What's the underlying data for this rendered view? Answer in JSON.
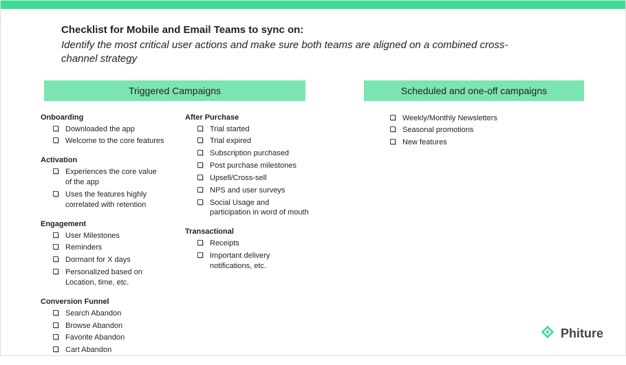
{
  "header": {
    "title": "Checklist for Mobile and Email Teams to sync on:",
    "subtitle": "Identify the most critical user actions and make sure both teams are aligned on a combined cross-channel strategy"
  },
  "panels": {
    "triggered": {
      "heading": "Triggered Campaigns",
      "left_groups": [
        {
          "title": "Onboarding",
          "items": [
            "Downloaded the app",
            "Welcome to the core features"
          ]
        },
        {
          "title": "Activation",
          "items": [
            "Experiences the core value of the app",
            "Uses the features highly correlated with retention"
          ]
        },
        {
          "title": "Engagement",
          "items": [
            "User Milestones",
            "Reminders",
            "Dormant for X days",
            "Personalized based on Location, time, etc."
          ]
        },
        {
          "title": "Conversion Funnel",
          "items": [
            "Search Abandon",
            "Browse Abandon",
            "Favorite Abandon",
            "Cart Abandon"
          ]
        }
      ],
      "right_groups": [
        {
          "title": "After Purchase",
          "items": [
            "Trial started",
            "Trial expired",
            "Subscription purchased",
            "Post purchase milestones",
            "Upsell/Cross-sell",
            "NPS and user surveys",
            "Social Usage and participation in word of mouth"
          ]
        },
        {
          "title": "Transactional",
          "items": [
            "Receipts",
            "Important delivery notifications, etc."
          ]
        }
      ]
    },
    "scheduled": {
      "heading": "Scheduled and one-off campaigns",
      "items": [
        "Weekly/Monthly Newsletters",
        "Seasonal promotions",
        "New features"
      ]
    }
  },
  "brand": {
    "name": "Phiture"
  },
  "colors": {
    "accent": "#3ddc97",
    "panel": "#7be5b0"
  }
}
